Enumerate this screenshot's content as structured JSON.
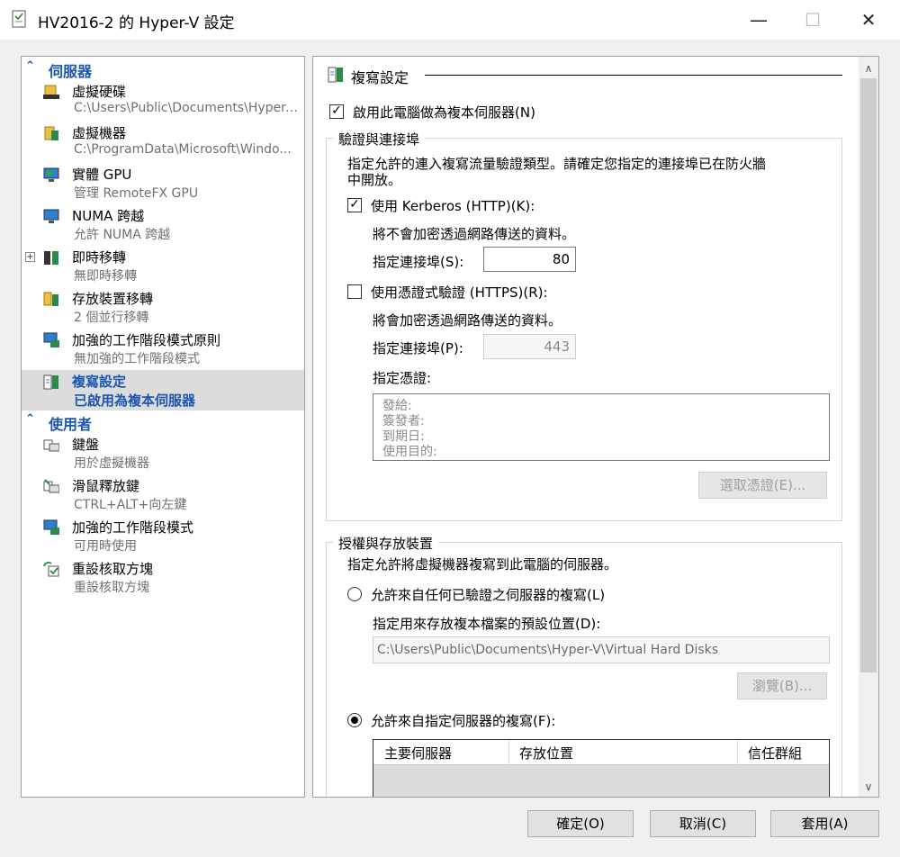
{
  "window": {
    "title": "HV2016-2 的 Hyper-V 設定",
    "minimize": "—",
    "maximize": "☐",
    "close": "✕"
  },
  "sidebar": {
    "sections": [
      {
        "label": "伺服器"
      },
      {
        "label": "使用者"
      }
    ],
    "items": [
      {
        "label": "虛擬硬碟",
        "sub": "C:\\Users\\Public\\Documents\\Hyper-...",
        "icon": "hard-disk-icon"
      },
      {
        "label": "虛擬機器",
        "sub": "C:\\ProgramData\\Microsoft\\Windo...",
        "icon": "virtual-machine-icon"
      },
      {
        "label": "實體 GPU",
        "sub": "管理 RemoteFX GPU",
        "icon": "gpu-monitor-icon"
      },
      {
        "label": "NUMA 跨越",
        "sub": "允許 NUMA 跨越",
        "icon": "numa-monitor-icon"
      },
      {
        "label": "即時移轉",
        "sub": "無即時移轉",
        "icon": "live-migration-icon"
      },
      {
        "label": "存放裝置移轉",
        "sub": "2 個並行移轉",
        "icon": "storage-migration-icon"
      },
      {
        "label": "加強的工作階段模式原則",
        "sub": "無加強的工作階段模式",
        "icon": "enhanced-session-policy-icon"
      },
      {
        "label": "複寫設定",
        "sub": "已啟用為複本伺服器",
        "icon": "replication-icon"
      },
      {
        "label": "鍵盤",
        "sub": "用於虛擬機器",
        "icon": "keyboard-icon"
      },
      {
        "label": "滑鼠釋放鍵",
        "sub": "CTRL+ALT+向左鍵",
        "icon": "mouse-release-icon"
      },
      {
        "label": "加強的工作階段模式",
        "sub": "可用時使用",
        "icon": "enhanced-session-icon"
      },
      {
        "label": "重設核取方塊",
        "sub": "重設核取方塊",
        "icon": "reset-checkbox-icon"
      }
    ],
    "expand_symbol": "+"
  },
  "main": {
    "header": "複寫設定",
    "enable_replica": {
      "label": "啟用此電腦做為複本伺服器(N)",
      "checked": true
    },
    "auth_group": {
      "title": "驗證與連接埠",
      "desc_line1": "指定允許的連入複寫流量驗證類型。請確定您指定的連接埠已在防火牆",
      "desc_line2": "中開放。",
      "kerberos": {
        "label": "使用 Kerberos (HTTP)(K):",
        "checked": true,
        "note": "將不會加密透過網路傳送的資料。",
        "port_label": "指定連接埠(S):",
        "port": "80"
      },
      "cert": {
        "label": "使用憑證式驗證 (HTTPS)(R):",
        "checked": false,
        "note": "將會加密透過網路傳送的資料。",
        "port_label": "指定連接埠(P):",
        "port": "443"
      },
      "cert_label": "指定憑證:",
      "cert_fields": [
        "發給:",
        "簽發者:",
        "到期日:",
        "使用目的:"
      ],
      "select_cert_button": "選取憑證(E)..."
    },
    "auth_storage_group": {
      "title": "授權與存放裝置",
      "desc": "指定允許將虛擬機器複寫到此電腦的伺服器。",
      "any_server": {
        "label": "允許來自任何已驗證之伺服器的複寫(L)",
        "selected": false
      },
      "default_location_label": "指定用來存放複本檔案的預設位置(D):",
      "default_location": "C:\\Users\\Public\\Documents\\Hyper-V\\Virtual Hard Disks",
      "browse_button": "瀏覽(B)...",
      "specified_servers": {
        "label": "允許來自指定伺服器的複寫(F):",
        "selected": true
      },
      "table_headers": [
        "主要伺服器",
        "存放位置",
        "信任群組"
      ]
    },
    "scroll_up": "∧",
    "scroll_down": "∨"
  },
  "footer": {
    "ok": "確定(O)",
    "cancel": "取消(C)",
    "apply": "套用(A)"
  }
}
